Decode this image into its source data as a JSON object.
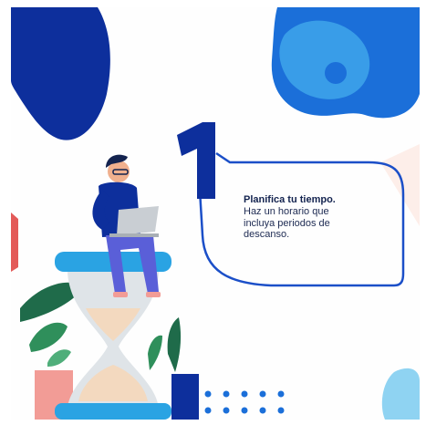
{
  "tip": {
    "step_number": "1",
    "title": "Planifica tu tiempo.",
    "body_lines": [
      "Haz un horario que",
      "incluya periodos de",
      "descanso."
    ]
  },
  "colors": {
    "navy": "#0d2f9c",
    "blue": "#1b6fd9",
    "sky": "#2aa3e3",
    "light_blue": "#5bc4ee",
    "green": "#2e8b57",
    "pink": "#f4a6a0",
    "sand": "#f3d9bf",
    "gray": "#cfd5da"
  },
  "illustration": {
    "person": "person-with-laptop",
    "object": "hourglass",
    "plants": "plant-leaves",
    "dots": "dot-grid"
  }
}
